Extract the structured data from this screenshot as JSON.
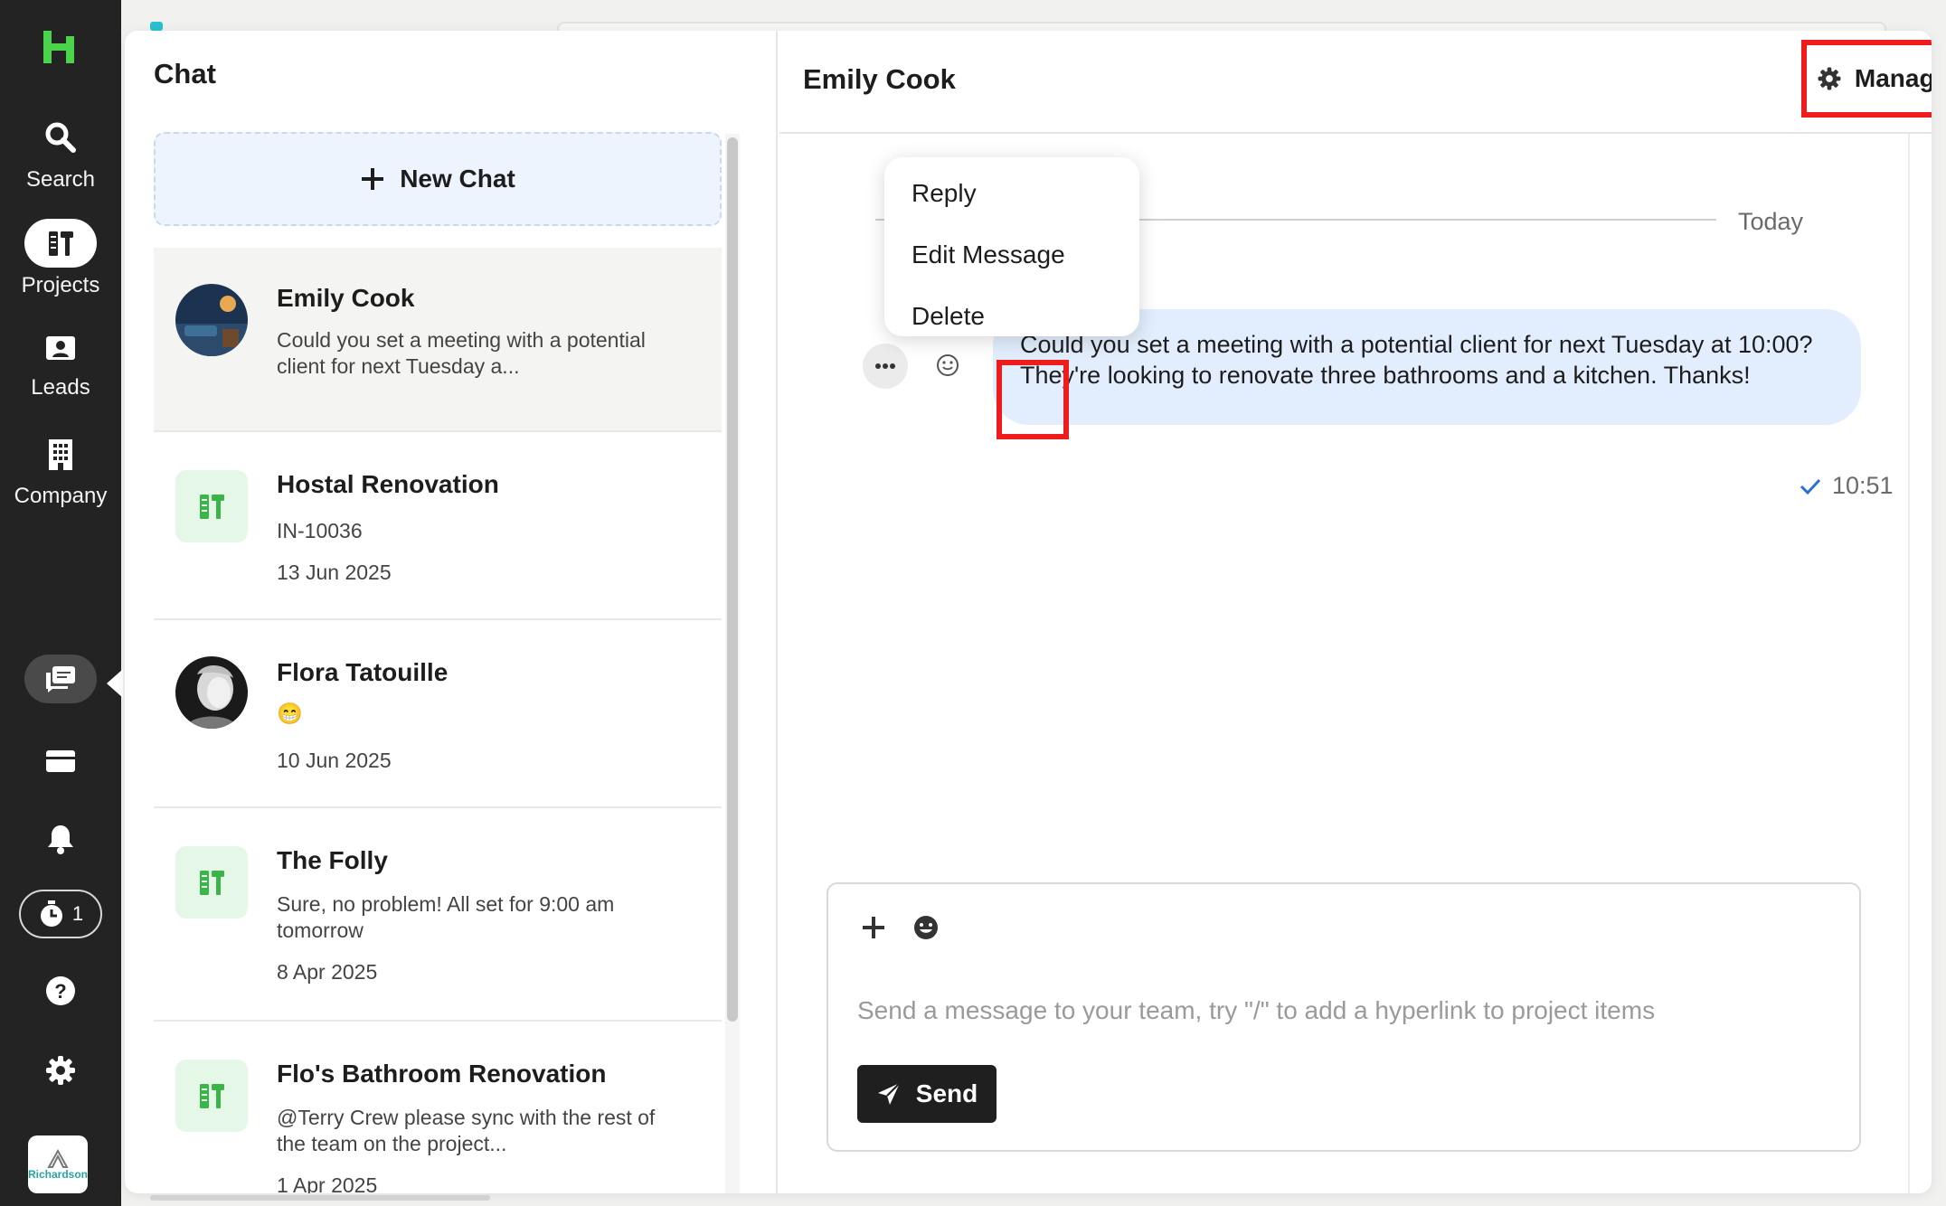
{
  "colors": {
    "rail_bg": "#232323",
    "brand_green": "#4ad44a",
    "bubble_bg": "#e2eefd",
    "highlight_red": "#ee1c1c",
    "send_bg": "#1f1f1f"
  },
  "nav": {
    "logo_icon": "brand-logo-icon",
    "items": [
      {
        "label": "Search",
        "icon": "search-icon"
      },
      {
        "label": "Projects",
        "icon": "projects-icon"
      },
      {
        "label": "Leads",
        "icon": "leads-icon"
      },
      {
        "label": "Company",
        "icon": "company-icon"
      }
    ],
    "bottom_icons": [
      "chat-icon",
      "inbox-icon",
      "bell-icon",
      "timer-icon",
      "help-icon",
      "gear-icon"
    ],
    "timer_count": "1",
    "company_logo_text": "Richardson"
  },
  "list": {
    "title": "Chat",
    "new_chat_label": "New Chat",
    "conversations": [
      {
        "name": "Emily Cook",
        "preview": "Could you set a meeting with a potential client for next Tuesday a...",
        "type": "person"
      },
      {
        "name": "Hostal Renovation",
        "preview": "IN-10036",
        "date": "13 Jun 2025",
        "type": "project"
      },
      {
        "name": "Flora Tatouille",
        "preview": "😁",
        "date": "10 Jun 2025",
        "type": "person"
      },
      {
        "name": "The Folly",
        "preview": "Sure, no problem! All set for 9:00 am tomorrow",
        "date": "8 Apr 2025",
        "type": "project"
      },
      {
        "name": "Flo's Bathroom Renovation",
        "preview": "@Terry Crew please sync with the rest of the team on the project...",
        "date": "1 Apr 2025",
        "type": "project"
      }
    ]
  },
  "conversation": {
    "title": "Emily Cook",
    "manage_label": "Manage Chat",
    "day_label": "Today",
    "message": {
      "text": "Could you set a meeting with a potential client for next Tuesday at 10:00? They're looking to renovate three bathrooms and a kitchen. Thanks!",
      "time": "10:51"
    },
    "context_menu": [
      "Reply",
      "Edit Message",
      "Delete"
    ],
    "composer": {
      "placeholder": "Send a message to your team, try \"/\" to add a hyperlink to project items",
      "send_label": "Send"
    }
  }
}
